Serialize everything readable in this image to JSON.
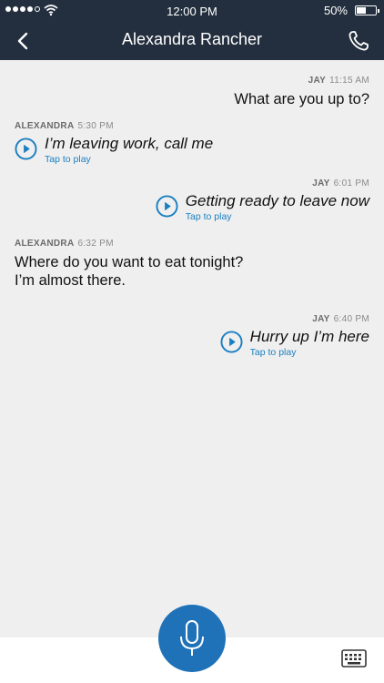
{
  "status": {
    "time": "12:00 PM",
    "battery": "50%",
    "battery_level": 0.5
  },
  "header": {
    "title": "Alexandra Rancher"
  },
  "messages": [
    {
      "sender": "JAY",
      "time": "11:15 AM",
      "text": "What are you up to?"
    },
    {
      "sender": "ALEXANDRA",
      "time": "5:30 PM",
      "voice_text": "I’m leaving work, call me",
      "tap_label": "Tap to play"
    },
    {
      "sender": "JAY",
      "time": "6:01 PM",
      "voice_text": "Getting ready to leave now",
      "tap_label": "Tap to play"
    },
    {
      "sender": "ALEXANDRA",
      "time": "6:32 PM",
      "text_lines": [
        "Where do you want to eat tonight?",
        "I’m almost there."
      ]
    },
    {
      "sender": "JAY",
      "time": "6:40 PM",
      "voice_text": "Hurry up I’m here",
      "tap_label": "Tap to play"
    }
  ],
  "colors": {
    "header_bg": "#232f3e",
    "accent": "#1f72b8",
    "link": "#1a7fc1",
    "background": "#efefef"
  },
  "icons": {
    "back": "chevron-left-icon",
    "call": "phone-icon",
    "play": "play-circle-icon",
    "mic": "microphone-icon",
    "keyboard": "keyboard-icon"
  }
}
